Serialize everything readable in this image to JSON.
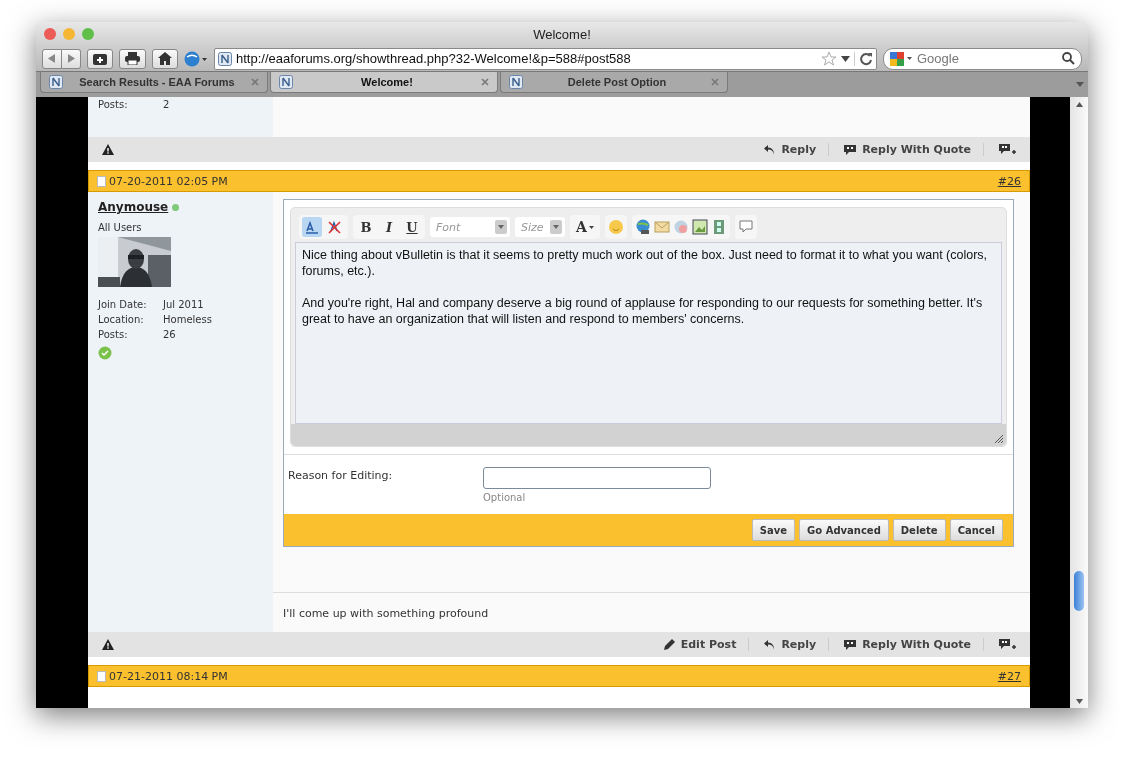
{
  "window": {
    "title": "Welcome!"
  },
  "toolbar": {
    "url": "http://eaaforums.org/showthread.php?32-Welcome!&p=588#post588",
    "search_placeholder": "Google"
  },
  "tabs": [
    {
      "label": "Search Results - EAA Forums",
      "selected": false
    },
    {
      "label": "Welcome!",
      "selected": true
    },
    {
      "label": "Delete Post Option",
      "selected": false
    }
  ],
  "previous_post": {
    "stats": [
      {
        "label": "Posts:",
        "value": "2"
      }
    ],
    "actions": [
      {
        "kind": "reply",
        "label": "Reply"
      },
      {
        "kind": "quote",
        "label": "Reply With Quote"
      }
    ]
  },
  "post": {
    "date": "07-20-2011 02:05 PM",
    "number": "#26",
    "author": {
      "name": "Anymouse",
      "online": true,
      "title": "All Users",
      "stats": [
        {
          "label": "Join Date:",
          "value": "Jul 2011"
        },
        {
          "label": "Location:",
          "value": "Homeless"
        },
        {
          "label": "Posts:",
          "value": "26"
        }
      ]
    },
    "editor": {
      "format_buttons": [
        "B",
        "I",
        "U"
      ],
      "font_placeholder": "Font",
      "size_placeholder": "Size",
      "color_button": "A",
      "message": "Nice thing about vBulletin is that it seems to pretty much work out of the box. Just need to format it to what you want (colors, forums, etc.).\n\nAnd you're right, Hal and company deserve a big round of applause for responding to our requests for something better. It's great to have an organization that will listen and respond to members' concerns.",
      "reason_label": "Reason for Editing:",
      "reason_note": "Optional",
      "buttons": [
        "Save",
        "Go Advanced",
        "Delete",
        "Cancel"
      ]
    },
    "signature": "I'll come up with something profound",
    "actions": [
      {
        "kind": "edit",
        "label": "Edit Post"
      },
      {
        "kind": "reply",
        "label": "Reply"
      },
      {
        "kind": "quote",
        "label": "Reply With Quote"
      }
    ]
  },
  "next_post": {
    "date": "07-21-2011 08:14 PM",
    "number": "#27"
  }
}
